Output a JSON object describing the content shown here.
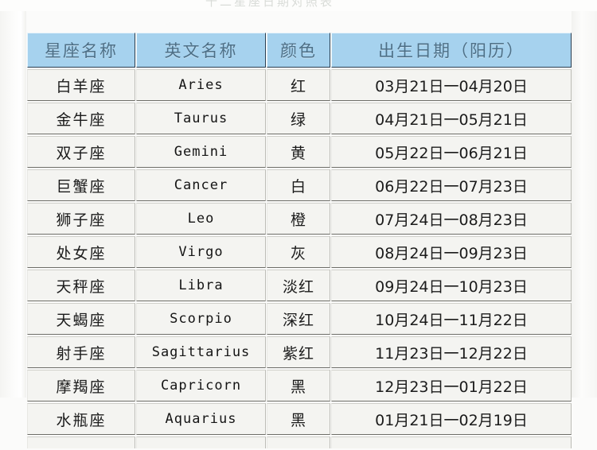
{
  "page": {
    "background_color": "#fbfbfa",
    "clipped_top_text": "十二星座日期对照表",
    "header_fill_color": "#a6d2ee",
    "header_text_color": "#4d6f86",
    "cell_fill_color": "#f4f4f1"
  },
  "table": {
    "name": "zodiac-date-table",
    "columns": [
      {
        "key": "cn_name",
        "label": "星座名称"
      },
      {
        "key": "en_name",
        "label": "英文名称"
      },
      {
        "key": "color",
        "label": "颜色"
      },
      {
        "key": "date_range",
        "label": "出生日期（阳历）"
      }
    ],
    "rows": [
      {
        "cn_name": "白羊座",
        "en_name": "Aries",
        "color": "红",
        "date_range": "03月21日一04月20日"
      },
      {
        "cn_name": "金牛座",
        "en_name": "Taurus",
        "color": "绿",
        "date_range": "04月21日一05月21日"
      },
      {
        "cn_name": "双子座",
        "en_name": "Gemini",
        "color": "黄",
        "date_range": "05月22日一06月21日"
      },
      {
        "cn_name": "巨蟹座",
        "en_name": "Cancer",
        "color": "白",
        "date_range": "06月22日一07月23日"
      },
      {
        "cn_name": "狮子座",
        "en_name": "Leo",
        "color": "橙",
        "date_range": "07月24日一08月23日"
      },
      {
        "cn_name": "处女座",
        "en_name": "Virgo",
        "color": "灰",
        "date_range": "08月24日一09月23日"
      },
      {
        "cn_name": "天秤座",
        "en_name": "Libra",
        "color": "淡红",
        "date_range": "09月24日一10月23日"
      },
      {
        "cn_name": "天蝎座",
        "en_name": "Scorpio",
        "color": "深红",
        "date_range": "10月24日一11月22日"
      },
      {
        "cn_name": "射手座",
        "en_name": "Sagittarius",
        "color": "紫红",
        "date_range": "11月23日一12月22日"
      },
      {
        "cn_name": "摩羯座",
        "en_name": "Capricorn",
        "color": "黑",
        "date_range": "12月23日一01月22日"
      },
      {
        "cn_name": "水瓶座",
        "en_name": "Aquarius",
        "color": "黑",
        "date_range": "01月21日一02月19日"
      }
    ]
  }
}
